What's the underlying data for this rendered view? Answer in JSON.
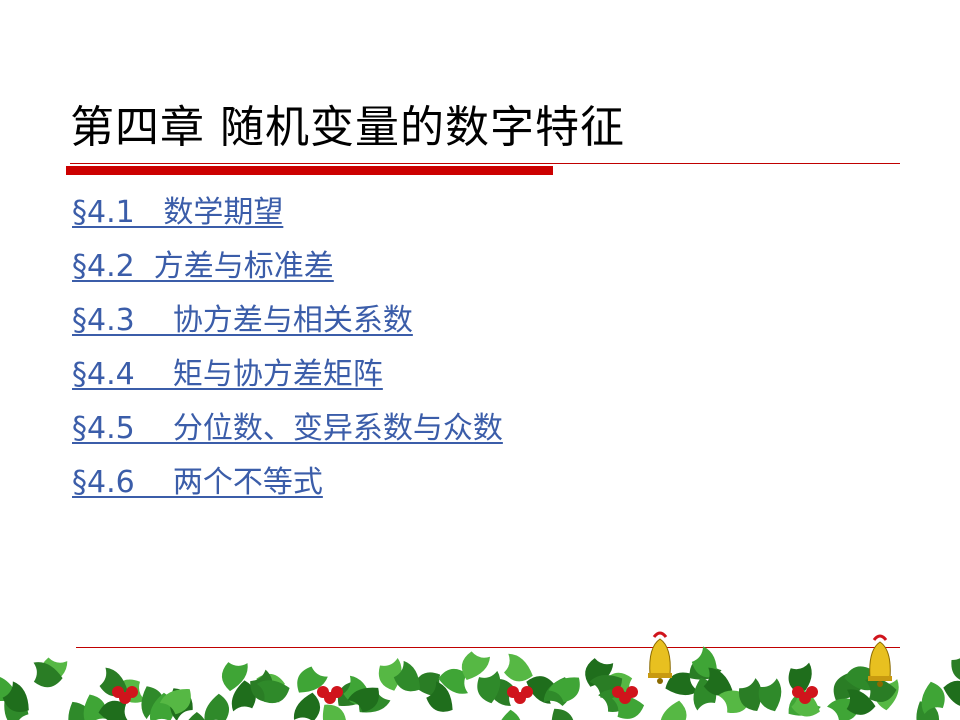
{
  "slide": {
    "title": "第四章 随机变量的数字特征",
    "toc": [
      {
        "label": "§4.1   数学期望"
      },
      {
        "label": "§4.2  方差与标准差"
      },
      {
        "label": "§4.3    协方差与相关系数"
      },
      {
        "label": "§4.4    矩与协方差矩阵"
      },
      {
        "label": "§4.5    分位数、变异系数与众数"
      },
      {
        "label": "§4.6    两个不等式"
      }
    ]
  },
  "colors": {
    "title_text": "#000000",
    "link_text": "#3b5da9",
    "rule_red": "#cc0000",
    "leaf_green": "#2f8a2a",
    "berry_red": "#d0141c",
    "bell_gold": "#e8c020"
  },
  "decorations": {
    "footer": "holly-garland-with-bells"
  }
}
